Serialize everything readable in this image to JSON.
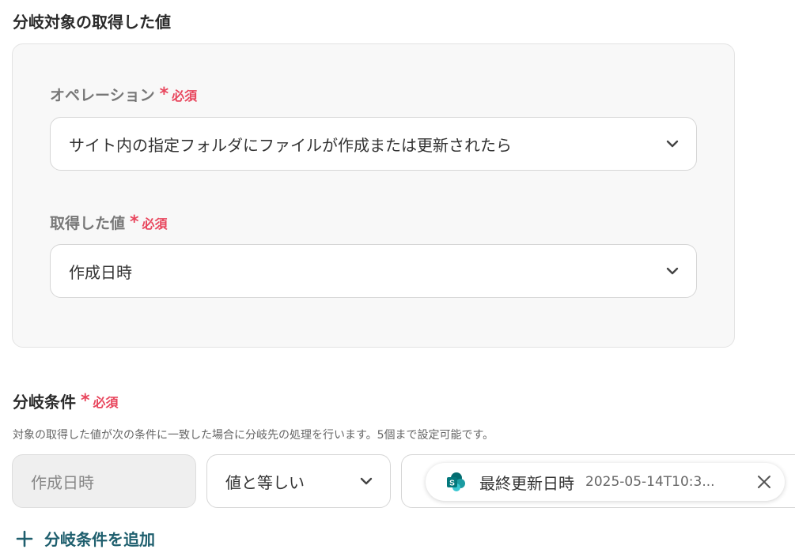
{
  "section": {
    "title": "分岐対象の取得した値"
  },
  "required": {
    "star": "*",
    "text": "必須"
  },
  "operation": {
    "label": "オペレーション",
    "value": "サイト内の指定フォルダにファイルが作成または更新されたら"
  },
  "acquired_value": {
    "label": "取得した値",
    "value": "作成日時"
  },
  "condition": {
    "title": "分岐条件",
    "description": "対象の取得した値が次の条件に一致した場合に分岐先の処理を行います。5個まで設定可能です。",
    "field_value": "作成日時",
    "operator": "値と等しい",
    "chip": {
      "icon": "sharepoint-icon",
      "label": "最終更新日時",
      "value": "2025-05-14T10:3..."
    },
    "add_label": "分岐条件を追加"
  },
  "colors": {
    "required": "#e8465d",
    "accent": "#1f5f6e",
    "sharepoint_dark": "#036c70",
    "sharepoint_mid": "#1a9ba1",
    "sharepoint_light": "#37c6d0"
  }
}
